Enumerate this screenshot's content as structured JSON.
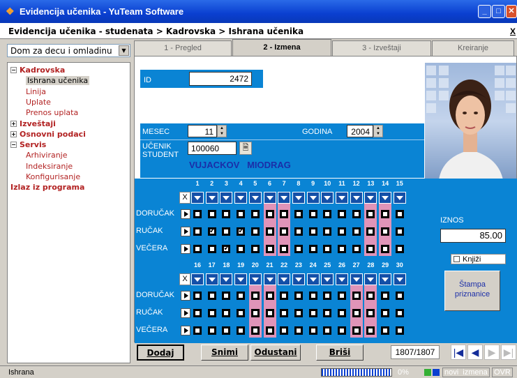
{
  "window": {
    "title": "Evidencija učenika - YuTeam Software",
    "icon": "app-icon",
    "buttons": {
      "min": "_",
      "max": "□",
      "close": "X"
    }
  },
  "breadcrumb": {
    "text": "Evidencija učenika - studenata > Kadrovska > Ishrana učenika",
    "close_hint": "X"
  },
  "left": {
    "combo_value": "Dom za decu i omladinu",
    "tree": [
      {
        "label": "Kadrovska",
        "level": 0,
        "expander": "−"
      },
      {
        "label": "Ishrana učenika",
        "level": 1,
        "selected": true
      },
      {
        "label": "Linija",
        "level": 1
      },
      {
        "label": "Uplate",
        "level": 1
      },
      {
        "label": "Prenos uplata",
        "level": 1
      },
      {
        "label": "Izveštaji",
        "level": 0,
        "expander": "+"
      },
      {
        "label": "Osnovni podaci",
        "level": 0,
        "expander": "+"
      },
      {
        "label": "Servis",
        "level": 0,
        "expander": "−"
      },
      {
        "label": "Arhiviranje",
        "level": 1
      },
      {
        "label": "Indeksiranje",
        "level": 1
      },
      {
        "label": "Konfigurisanje",
        "level": 1
      },
      {
        "label": "Izlaz iz programa",
        "level": 0
      }
    ]
  },
  "tabs": [
    {
      "label": "1 - Pregled",
      "active": false
    },
    {
      "label": "2 - Izmena",
      "active": true
    },
    {
      "label": "3 - Izveštaji",
      "active": false
    },
    {
      "label": "Kreiranje",
      "active": false
    }
  ],
  "form": {
    "id_label": "ID",
    "id_value": "2472",
    "mesec_label": "MESEC",
    "mesec_value": "11",
    "godina_label": "GODINA",
    "godina_value": "2004",
    "ucenik_label": "UČENIK",
    "student_label": "STUDENT",
    "ucenik_value": "100060",
    "student_name": "VUJACKOV   MIODRAG"
  },
  "grid": {
    "rows": [
      "DORUČAK",
      "RUČAK",
      "VEČERA"
    ],
    "x_label": "X",
    "block1_days": [
      "1",
      "2",
      "3",
      "4",
      "5",
      "6",
      "7",
      "8",
      "9",
      "10",
      "11",
      "12",
      "13",
      "14",
      "15"
    ],
    "block2_days": [
      "16",
      "17",
      "18",
      "19",
      "20",
      "21",
      "22",
      "23",
      "24",
      "25",
      "26",
      "27",
      "28",
      "29",
      "30"
    ],
    "block1_weekend": [
      6,
      7,
      13,
      14
    ],
    "block2_weekend": [
      20,
      21,
      27,
      28
    ],
    "block1_checked": {
      "RUČAK": [
        2,
        4
      ],
      "VEČERA": [
        3
      ]
    },
    "block2_checked": {}
  },
  "right": {
    "iznos_label": "IZNOS",
    "iznos_value": "85.00",
    "knjizi_label": "Knjiži",
    "stampa_label": "Štampa priznanice"
  },
  "toolbar": {
    "dodaj": "Dodaj",
    "snimi": "Snimi",
    "odustani": "Odustani",
    "brisi": "Briši",
    "record": "1807/1807"
  },
  "status": {
    "left": "Ishrana",
    "progress_pct": "0%",
    "mode": "novi  izmena",
    "ovr": "OVR"
  }
}
